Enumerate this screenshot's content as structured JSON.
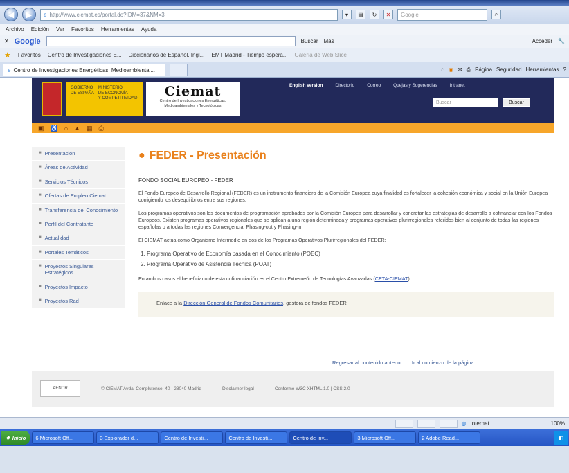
{
  "browser": {
    "url": "http://www.ciemat.es/portal.do?IDM=37&NM=3",
    "search_placeholder": "Google",
    "menu": [
      "Archivo",
      "Edición",
      "Ver",
      "Favoritos",
      "Herramientas",
      "Ayuda"
    ],
    "google_logo": "Google",
    "google_buttons": [
      "Buscar",
      "Más",
      "Acceder"
    ],
    "favorites_label": "Favoritos",
    "favorites": [
      "Centro de Investigaciones E...",
      "Diccionarios de Español, Ingl...",
      "EMT Madrid - Tiempo espera...",
      "Galería de Web Slice"
    ],
    "tab_title": "Centro de Investigaciones Energéticas, Medioambiental...",
    "command_items": [
      "Página",
      "Seguridad",
      "Herramientas"
    ],
    "status_zone": "Internet",
    "zoom": "100%"
  },
  "site": {
    "gov_lines": [
      "GOBIERNO",
      "DE ESPAÑA"
    ],
    "ministry_lines": [
      "MINISTERIO",
      "DE ECONOMÍA",
      "Y COMPETITIVIDAD"
    ],
    "logo_name": "Ciemat",
    "logo_sub": "Centro de Investigaciones Energéticas, Medioambientales y Tecnológicas",
    "top_nav": [
      "English version",
      "Directorio",
      "Correo",
      "Quejas y Sugerencias",
      "Intranet"
    ],
    "search_placeholder": "Buscar",
    "search_button": "Buscar"
  },
  "sidebar": {
    "items": [
      "Presentación",
      "Áreas de Actividad",
      "Servicios Técnicos",
      "Ofertas de Empleo Ciemat",
      "Transferencia del Conocimiento",
      "Perfil del Contratante",
      "Actualidad",
      "Portales Temáticos",
      "Proyectos Singulares Estratégicos",
      "Proyectos Impacto",
      "Proyectos Rad"
    ]
  },
  "content": {
    "title": "FEDER - Presentación",
    "subtitle": "FONDO SOCIAL EUROPEO - FEDER",
    "p1": "El Fondo Europeo de Desarrollo Regional (FEDER) es un instrumento financiero de la Comisión Europea cuya finalidad es fortalecer la cohesión económica y social en la Unión Europea corrigiendo los desequilibrios entre sus regiones.",
    "p2": "Los programas operativos son los documentos de programación aprobados por la Comisión Europea para desarrollar y concretar las estrategias de desarrollo a cofinanciar con los Fondos Europeos. Existen programas operativos regionales que se aplican a una región determinada y programas operativos plurirregionales referidos bien al conjunto de todas las regiones españolas o a todas las regiones Convergencia, Phasing-out y Phasing-in.",
    "p3": "El CIEMAT actúa como Organismo Intermedio en dos de los Programas Operativos Plurirregionales del FEDER:",
    "list": [
      "Programa Operativo de Economía basada en el Conocimiento (POEC)",
      "Programa Operativo de Asistencia Técnica (POAT)"
    ],
    "p4_prefix": "En ambos casos el beneficiario de esta cofinanciación es el Centro Extremeño de Tecnologías Avanzadas (",
    "p4_link": "CETA-CIEMAT",
    "p4_suffix": ")",
    "box_prefix": "Enlace a la ",
    "box_link": "Dirección General de Fondos Comunitarios",
    "box_suffix": ", gestora de fondos FEDER",
    "back_links": [
      "Regresar al contenido anterior",
      "Ir al comienzo de la página"
    ]
  },
  "footer": {
    "badge": "AENOR",
    "copyright": "© CIEMAT Avda. Complutense, 40 - 28040 Madrid",
    "legal": "Disclaimer legal",
    "conform": "Conforme W3C XHTML 1.0 | CSS 2.0"
  },
  "taskbar": {
    "start": "Inicio",
    "tasks": [
      "6 Microsoft Off...",
      "3 Explorador d...",
      "Centro de Investi...",
      "Centro de Investi...",
      "Centro de Inv...",
      "3 Microsoft Off...",
      "2 Adobe Read..."
    ]
  }
}
